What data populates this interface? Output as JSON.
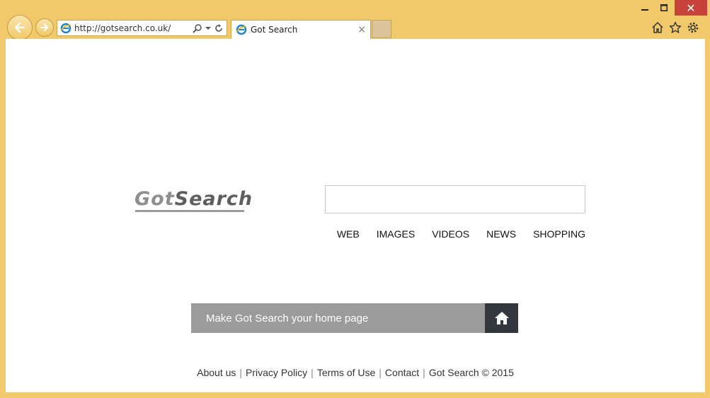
{
  "browser": {
    "url": "http://gotsearch.co.uk/",
    "tab_title": "Got Search",
    "tab_close": "×",
    "window": {
      "close": "✕"
    }
  },
  "page": {
    "logo_part1": "Got",
    "logo_part2": "Search",
    "search_placeholder": "",
    "verticals": [
      "WEB",
      "IMAGES",
      "VIDEOS",
      "NEWS",
      "SHOPPING"
    ],
    "homepage_label": "Make Got Search your home page",
    "footer": {
      "links": [
        "About us",
        "Privacy Policy",
        "Terms of Use",
        "Contact"
      ],
      "copyright": "Got Search © 2015",
      "separator": "|"
    }
  },
  "colors": {
    "chrome": "#f1c86a",
    "close_button": "#c7423a",
    "homepage_bar": "#9b9b9b",
    "home_button": "#33383e"
  }
}
